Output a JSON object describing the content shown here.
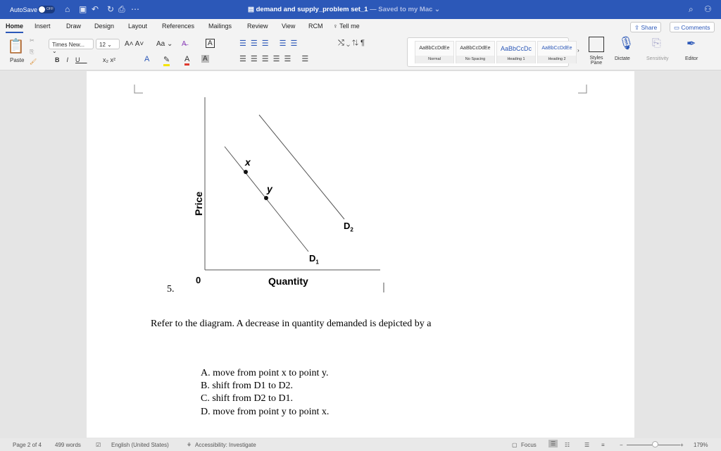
{
  "titlebar": {
    "autosave": "AutoSave",
    "toggle": "OFF",
    "title": "demand and supply_problem set_1",
    "saved": " — Saved to my Mac ⌄"
  },
  "tabs": [
    "Home",
    "Insert",
    "Draw",
    "Design",
    "Layout",
    "References",
    "Mailings",
    "Review",
    "View",
    "RCM",
    "Tell me"
  ],
  "share": "Share",
  "comments": "Comments",
  "ribbon": {
    "paste": "Paste",
    "font": "Times New...",
    "size": "12",
    "styles": [
      {
        "sample": "AaBbCcDdEe",
        "name": "Normal"
      },
      {
        "sample": "AaBbCcDdEe",
        "name": "No Spacing"
      },
      {
        "sample": "AaBbCcDc",
        "name": "Heading 1"
      },
      {
        "sample": "AaBbCcDdEe",
        "name": "Heading 2"
      }
    ],
    "styles_pane": "Styles Pane",
    "dictate": "Dictate",
    "sensitivity": "Sensitivity",
    "editor": "Editor"
  },
  "diagram": {
    "ylabel": "Price",
    "xlabel": "Quantity",
    "origin": "0",
    "point_x": "x",
    "point_y": "y",
    "d1": "D",
    "d1sub": "1",
    "d2": "D",
    "d2sub": "2"
  },
  "question": {
    "number": "5.",
    "text": "Refer to the diagram. A decrease in quantity demanded is depicted by a",
    "options": [
      "A.  move from point x to point y.",
      "B.  shift from D1 to D2.",
      "C.  shift from D2 to D1.",
      "D.  move from point y to point x."
    ]
  },
  "status": {
    "page": "Page 2 of 4",
    "words": "499 words",
    "language": "English (United States)",
    "accessibility": "Accessibility: Investigate",
    "focus": "Focus",
    "zoom": "179%",
    "zoom_level": 179
  }
}
